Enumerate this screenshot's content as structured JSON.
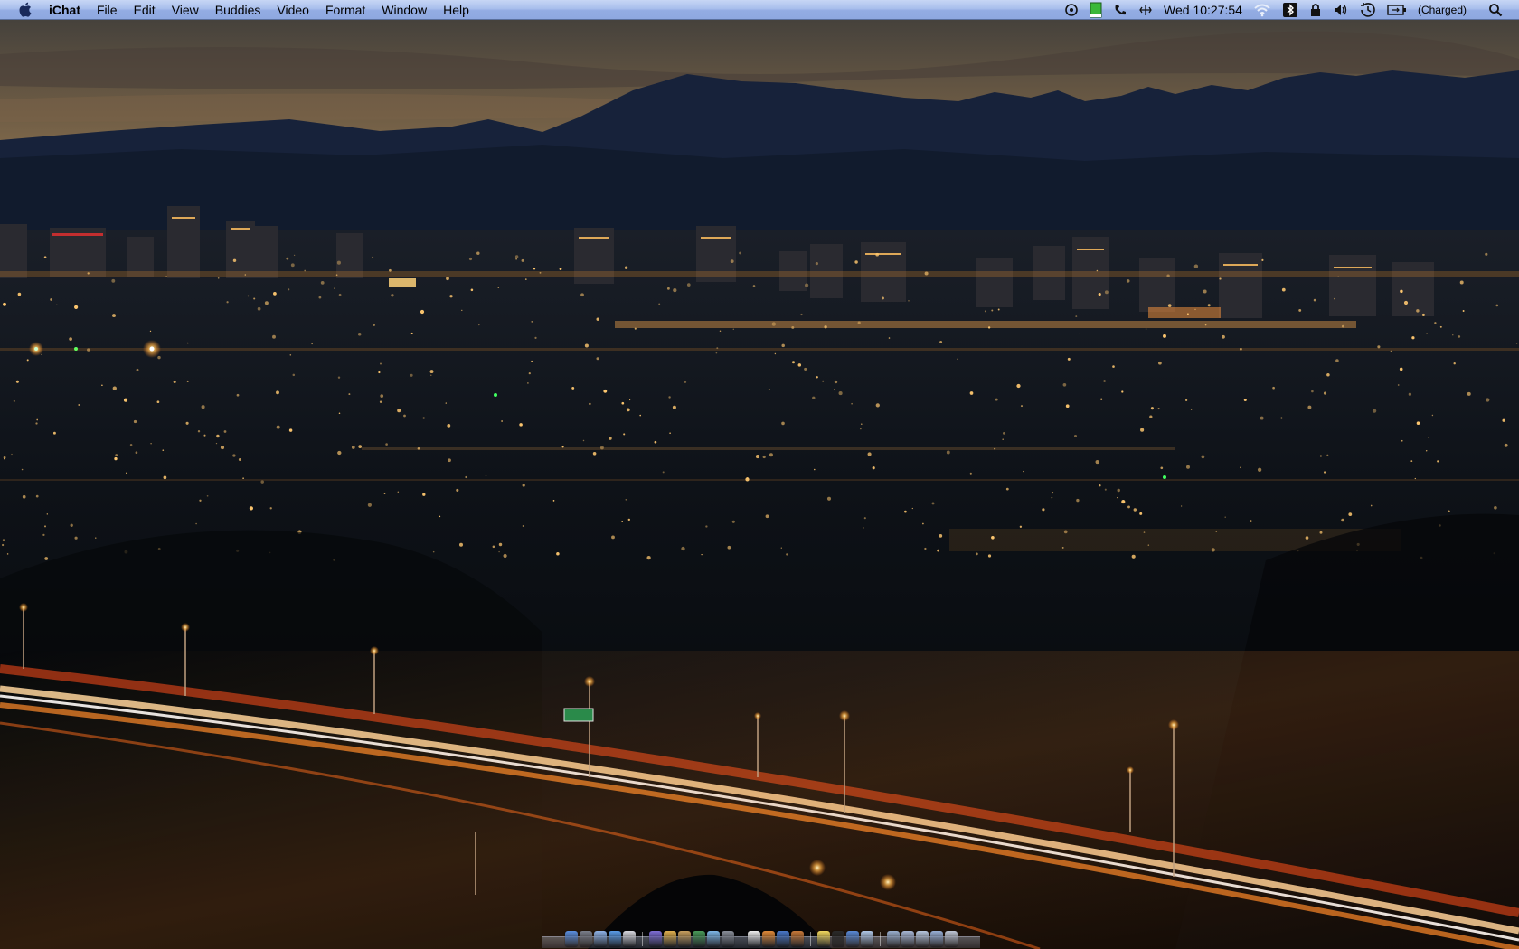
{
  "menubar": {
    "apple_menu": "apple-logo",
    "app_name": "iChat",
    "items": [
      "File",
      "Edit",
      "View",
      "Buddies",
      "Video",
      "Format",
      "Window",
      "Help"
    ],
    "clock": "Wed 10:27:54",
    "battery_status": "(Charged)",
    "status_icons": [
      "sync-icon",
      "battery-meter-icon",
      "phone-icon",
      "network-icon",
      "clock-icon",
      "wifi-icon",
      "bluetooth-icon",
      "lock-icon",
      "volume-icon",
      "time-machine-icon",
      "battery-icon",
      "spotlight-icon"
    ]
  },
  "wallpaper": {
    "description_colors": {
      "sky_top": "#3a3a3a",
      "sky_glow": "#8f7450",
      "mountains": "#13203a",
      "city_lights": "#ffb347",
      "highway_trails": "#ff5a1f"
    }
  },
  "dock": {
    "icons": [
      {
        "name": "finder-icon",
        "color": "#5b8fe0"
      },
      {
        "name": "dashboard-icon",
        "color": "#7a7f8c"
      },
      {
        "name": "mail-icon",
        "color": "#8fb3e8"
      },
      {
        "name": "safari-icon",
        "color": "#5b9de8"
      },
      {
        "name": "ical-icon",
        "color": "#d9d9e0"
      },
      {
        "name": "ichat-icon",
        "color": "#7f6fd8"
      },
      {
        "name": "address-book-icon",
        "color": "#e0b050"
      },
      {
        "name": "preview-icon",
        "color": "#c8a060"
      },
      {
        "name": "iphoto-icon",
        "color": "#4a9a5a"
      },
      {
        "name": "itunes-icon",
        "color": "#7fb8e8"
      },
      {
        "name": "system-preferences-icon",
        "color": "#8a8f9a"
      },
      {
        "name": "textedit-icon",
        "color": "#f0f0f0"
      },
      {
        "name": "pages-icon",
        "color": "#e08a3a"
      },
      {
        "name": "keynote-icon",
        "color": "#4a78c8"
      },
      {
        "name": "numbers-icon",
        "color": "#c87a3a"
      },
      {
        "name": "stickies-icon",
        "color": "#f0d860"
      },
      {
        "name": "terminal-icon",
        "color": "#2a2a2a"
      },
      {
        "name": "quicktime-icon",
        "color": "#5a8ad8"
      },
      {
        "name": "app-store-icon",
        "color": "#b0c8e8"
      },
      {
        "name": "documents-stack-icon",
        "color": "#9ab0d0"
      },
      {
        "name": "downloads-stack-icon",
        "color": "#a8b8d8"
      },
      {
        "name": "applications-stack-icon",
        "color": "#b8c8e0"
      },
      {
        "name": "folder-stack-icon",
        "color": "#98b0d8"
      },
      {
        "name": "trash-icon",
        "color": "#c0c8d8"
      }
    ]
  }
}
